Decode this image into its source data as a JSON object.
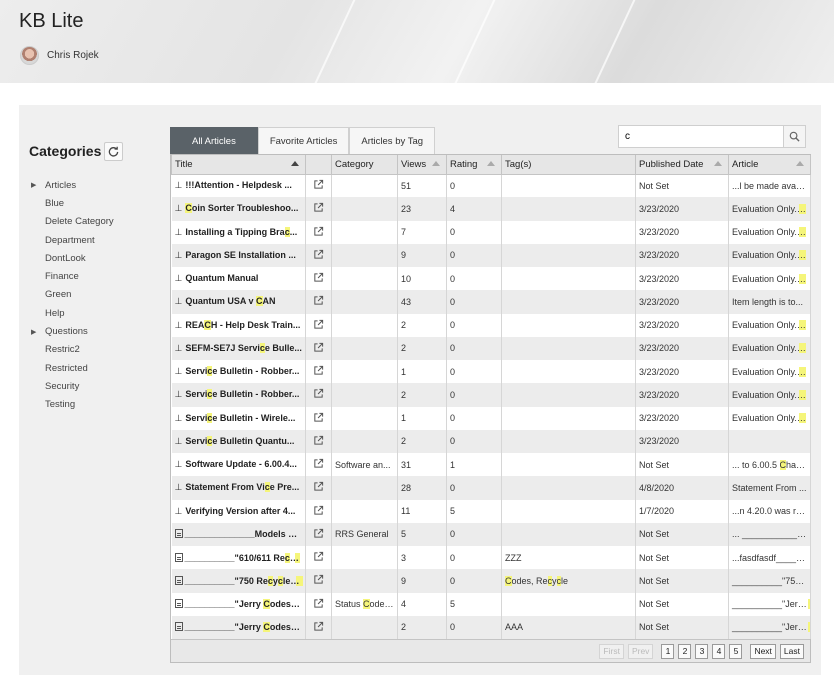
{
  "app": {
    "title": "KB Lite",
    "user_name": "Chris Rojek"
  },
  "sidebar": {
    "title": "Categories",
    "items": [
      {
        "label": "Articles",
        "expandable": true
      },
      {
        "label": "Blue",
        "expandable": false
      },
      {
        "label": "Delete Category",
        "expandable": false
      },
      {
        "label": "Department",
        "expandable": false
      },
      {
        "label": "DontLook",
        "expandable": false
      },
      {
        "label": "Finance",
        "expandable": false
      },
      {
        "label": "Green",
        "expandable": false
      },
      {
        "label": "Help",
        "expandable": false
      },
      {
        "label": "Questions",
        "expandable": true
      },
      {
        "label": "Restric2",
        "expandable": false
      },
      {
        "label": "Restricted",
        "expandable": false
      },
      {
        "label": "Security",
        "expandable": false
      },
      {
        "label": "Testing",
        "expandable": false
      }
    ]
  },
  "tabs": [
    "All Articles",
    "Favorite Articles",
    "Articles by Tag"
  ],
  "active_tab": 0,
  "search": {
    "value": "c",
    "placeholder": ""
  },
  "table": {
    "columns": [
      "Title",
      "",
      "Category",
      "Views",
      "Rating",
      "Tag(s)",
      "Published Date",
      "Article"
    ],
    "rows": [
      {
        "icon": "pin-icon",
        "title": "!!!Attention - Helpdesk ...",
        "category": "",
        "views": "51",
        "rating": "0",
        "tags": "",
        "published": "Not Set",
        "article": "...l be made avail..."
      },
      {
        "icon": "pin-icon",
        "title": "Coin Sorter Troubleshoo...",
        "category": "",
        "views": "23",
        "rating": "4",
        "tags": "",
        "published": "3/23/2020",
        "article": "Evaluation Only. C..."
      },
      {
        "icon": "pin-icon",
        "title": "Installing a Tipping Brac...",
        "category": "",
        "views": "7",
        "rating": "0",
        "tags": "",
        "published": "3/23/2020",
        "article": "Evaluation Only. C..."
      },
      {
        "icon": "pin-icon",
        "title": "Paragon SE Installation ...",
        "category": "",
        "views": "9",
        "rating": "0",
        "tags": "",
        "published": "3/23/2020",
        "article": "Evaluation Only. C..."
      },
      {
        "icon": "pin-icon",
        "title": "Quantum Manual",
        "category": "",
        "views": "10",
        "rating": "0",
        "tags": "",
        "published": "3/23/2020",
        "article": "Evaluation Only. C..."
      },
      {
        "icon": "pin-icon",
        "title": "Quantum USA v CAN",
        "category": "",
        "views": "43",
        "rating": "0",
        "tags": "",
        "published": "3/23/2020",
        "article": "Item length is to..."
      },
      {
        "icon": "pin-icon",
        "title": "REACH - Help Desk Train...",
        "category": "",
        "views": "2",
        "rating": "0",
        "tags": "",
        "published": "3/23/2020",
        "article": "Evaluation Only. C..."
      },
      {
        "icon": "pin-icon",
        "title": "SEFM-SE7J Service Bulle...",
        "category": "",
        "views": "2",
        "rating": "0",
        "tags": "",
        "published": "3/23/2020",
        "article": "Evaluation Only. C..."
      },
      {
        "icon": "pin-icon",
        "title": "Service Bulletin - Robber...",
        "category": "",
        "views": "1",
        "rating": "0",
        "tags": "",
        "published": "3/23/2020",
        "article": "Evaluation Only. C..."
      },
      {
        "icon": "pin-icon",
        "title": "Service Bulletin - Robber...",
        "category": "",
        "views": "2",
        "rating": "0",
        "tags": "",
        "published": "3/23/2020",
        "article": "Evaluation Only. C..."
      },
      {
        "icon": "pin-icon",
        "title": "Service Bulletin - Wirele...",
        "category": "",
        "views": "1",
        "rating": "0",
        "tags": "",
        "published": "3/23/2020",
        "article": "Evaluation Only. C..."
      },
      {
        "icon": "pin-icon",
        "title": "Service Bulletin Quantu...",
        "category": "",
        "views": "2",
        "rating": "0",
        "tags": "",
        "published": "3/23/2020",
        "article": ""
      },
      {
        "icon": "pin-icon",
        "title": "Software Update - 6.00.4...",
        "category": "Software an...",
        "views": "31",
        "rating": "1",
        "tags": "",
        "published": "Not Set",
        "article": "... to 6.00.5 Chan..."
      },
      {
        "icon": "pin-icon",
        "title": "Statement From Vice Pre...",
        "category": "",
        "views": "28",
        "rating": "0",
        "tags": "",
        "published": "4/8/2020",
        "article": "Statement From ..."
      },
      {
        "icon": "pin-icon",
        "title": "Verifying Version after 4...",
        "category": "",
        "views": "11",
        "rating": "5",
        "tags": "",
        "published": "1/7/2020",
        "article": "...n 4.20.0 was rel..."
      },
      {
        "icon": "document-icon",
        "title": "______________Models & S...",
        "category": "RRS General",
        "views": "5",
        "rating": "0",
        "tags": "",
        "published": "Not Set",
        "article": "... ________________..."
      },
      {
        "icon": "document-icon",
        "title": "__________\"610/611 Recyc...",
        "category": "",
        "views": "3",
        "rating": "0",
        "tags": "ZZZ",
        "published": "Not Set",
        "article": "...fasdfasdf______..."
      },
      {
        "icon": "document-icon",
        "title": "__________\"750 Recycler C...",
        "category": "",
        "views": "9",
        "rating": "0",
        "tags": "Codes, Recycle",
        "published": "Not Set",
        "article": "__________\"750 R..."
      },
      {
        "icon": "document-icon",
        "title": "__________\"Jerry Codes\"__...",
        "category": "Status Codes...",
        "views": "4",
        "rating": "5",
        "tags": "",
        "published": "Not Set",
        "article": "__________\"Jerry C..."
      },
      {
        "icon": "document-icon",
        "title": "__________\"Jerry Codes\"__...",
        "category": "",
        "views": "2",
        "rating": "0",
        "tags": "AAA",
        "published": "Not Set",
        "article": "__________\"Jerry C..."
      }
    ]
  },
  "pager": {
    "first": "First",
    "prev": "Prev",
    "pages": [
      "1",
      "2",
      "3",
      "4",
      "5"
    ],
    "next": "Next",
    "last": "Last"
  },
  "colors": {
    "active_tab": "#5a6268",
    "highlight": "#f5f57a",
    "panel_bg": "#f0f0f0"
  }
}
